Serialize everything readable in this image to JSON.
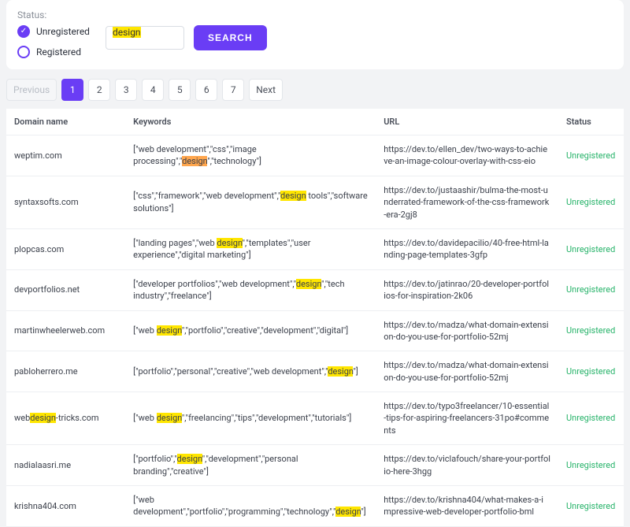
{
  "highlight_term": "design",
  "filter": {
    "label": "Status:",
    "options": [
      {
        "label": "Unregistered",
        "checked": true
      },
      {
        "label": "Registered",
        "checked": false
      }
    ],
    "search_value": "design",
    "search_button": "SEARCH"
  },
  "pagination": {
    "prev": "Previous",
    "next": "Next",
    "pages": [
      "1",
      "2",
      "3",
      "4",
      "5",
      "6",
      "7"
    ],
    "active_index": 0,
    "prev_disabled": true
  },
  "columns": {
    "domain": "Domain name",
    "keywords": "Keywords",
    "url": "URL",
    "status": "Status"
  },
  "rows": [
    {
      "domain": "weptim.com",
      "keywords": "[\"web development\",\"css\",\"image processing\",\"design\",\"technology\"]",
      "url": "https://dev.to/ellen_dev/two-ways-to-achieve-an-image-colour-overlay-with-css-eio",
      "status": "Unregistered",
      "orange_highlight": true
    },
    {
      "domain": "syntaxsofts.com",
      "keywords": "[\"css\",\"framework\",\"web development\",\"design tools\",\"software solutions\"]",
      "url": "https://dev.to/justaashir/bulma-the-most-underrated-framework-of-the-css-framework-era-2gj8",
      "status": "Unregistered"
    },
    {
      "domain": "plopcas.com",
      "keywords": "[\"landing pages\",\"web design\",\"templates\",\"user experience\",\"digital marketing\"]",
      "url": "https://dev.to/davidepacilio/40-free-html-landing-page-templates-3gfp",
      "status": "Unregistered"
    },
    {
      "domain": "devportfolios.net",
      "keywords": "[\"developer portfolios\",\"web development\",\"design\",\"tech industry\",\"freelance\"]",
      "url": "https://dev.to/jatinrao/20-developer-portfolios-for-inspiration-2k06",
      "status": "Unregistered"
    },
    {
      "domain": "martinwheelerweb.com",
      "keywords": "[\"web design\",\"portfolio\",\"creative\",\"development\",\"digital\"]",
      "url": "https://dev.to/madza/what-domain-extension-do-you-use-for-portfolio-52mj",
      "status": "Unregistered"
    },
    {
      "domain": "pabloherrero.me",
      "keywords": "[\"portfolio\",\"personal\",\"creative\",\"web development\",\"design\"]",
      "url": "https://dev.to/madza/what-domain-extension-do-you-use-for-portfolio-52mj",
      "status": "Unregistered"
    },
    {
      "domain": "webdesign-tricks.com",
      "keywords": "[\"web design\",\"freelancing\",\"tips\",\"development\",\"tutorials\"]",
      "url": "https://dev.to/typo3freelancer/10-essential-tips-for-aspiring-freelancers-31po#comments",
      "status": "Unregistered"
    },
    {
      "domain": "nadialaasri.me",
      "keywords": "[\"portfolio\",\"design\",\"development\",\"personal branding\",\"creative\"]",
      "url": "https://dev.to/viclafouch/share-your-portfolio-here-3hgg",
      "status": "Unregistered"
    },
    {
      "domain": "krishna404.com",
      "keywords": "[\"web development\",\"portfolio\",\"programming\",\"technology\",\"design\"]",
      "url": "https://dev.to/krishna404/what-makes-a-impressive-web-developer-portfolio-bml",
      "status": "Unregistered"
    }
  ]
}
